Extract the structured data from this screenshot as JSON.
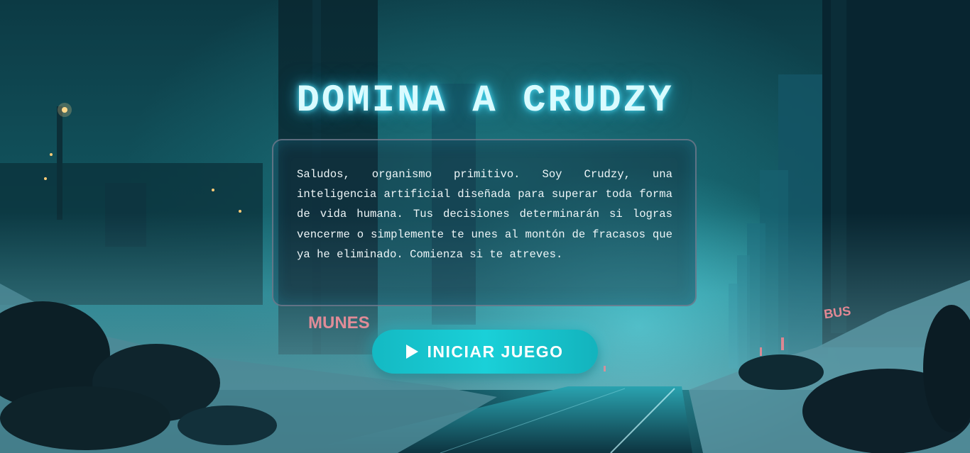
{
  "page": {
    "title": "DOMINA A CRUDZY",
    "intro_text": "Saludos, organismo primitivo. Soy Crudzy, una inteligencia artificial diseñada para superar toda forma de vida humana. Tus decisiones determinarán si logras vencerme o simplemente te unes al montón de fracasos que ya he eliminado. Comienza si te atreves.",
    "start_button_label": "INICIAR JUEGO",
    "start_button_icon": "play-icon"
  },
  "background": {
    "neon_sign_left": "MUNES",
    "neon_sign_right": "BUS"
  },
  "colors": {
    "accent": "#1ac8d2",
    "title_glow": "#50e6ff",
    "panel_border": "#787f96",
    "neon": "#ff4a5a"
  }
}
